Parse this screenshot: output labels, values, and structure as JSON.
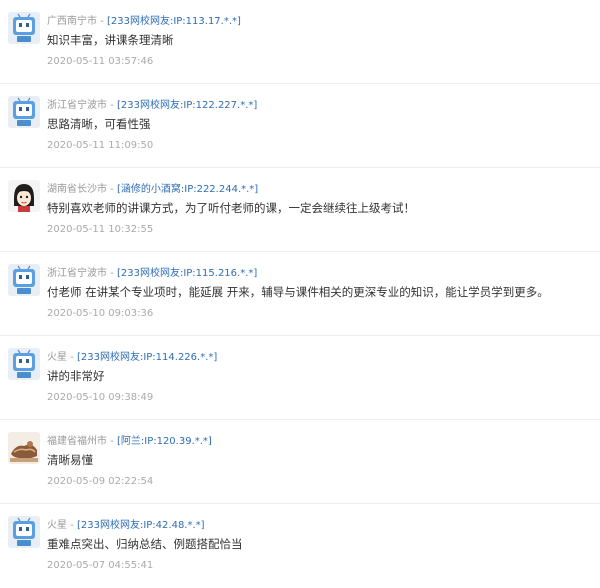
{
  "comments": [
    {
      "location": "广西南宁市",
      "user": "[233网校网友:IP:113.17.*.*]",
      "text": "知识丰富，讲课条理清晰",
      "time": "2020-05-11 03:57:46",
      "avatar": "robot-avatar-icon"
    },
    {
      "location": "浙江省宁波市",
      "user": "[233网校网友:IP:122.227.*.*]",
      "text": "思路清晰，可看性强",
      "time": "2020-05-11 11:09:50",
      "avatar": "robot-avatar-icon"
    },
    {
      "location": "湖南省长沙市",
      "user": "[涵修的小酒窝:IP:222.244.*.*]",
      "text": "特别喜欢老师的讲课方式，为了听付老师的课，一定会继续往上级考试！",
      "time": "2020-05-11 10:32:55",
      "avatar": "cartoon-girl-avatar-icon"
    },
    {
      "location": "浙江省宁波市",
      "user": "[233网校网友:IP:115.216.*.*]",
      "text": "付老师 在讲某个专业项时，能延展 开来，辅导与课件相关的更深专业的知识，能让学员学到更多。",
      "time": "2020-05-10 09:03:36",
      "avatar": "robot-avatar-icon"
    },
    {
      "location": "火星",
      "user": "[233网校网友:IP:114.226.*.*]",
      "text": "讲的非常好",
      "time": "2020-05-10 09:38:49",
      "avatar": "robot-avatar-icon"
    },
    {
      "location": "福建省福州市",
      "user": "[阿兰:IP:120.39.*.*]",
      "text": "清晰易懂",
      "time": "2020-05-09 02:22:54",
      "avatar": "photo-avatar-icon"
    },
    {
      "location": "火星",
      "user": "[233网校网友:IP:42.48.*.*]",
      "text": "重难点突出、归纳总结、例题搭配恰当",
      "time": "2020-05-07 04:55:41",
      "avatar": "robot-avatar-icon"
    }
  ],
  "separator": " - "
}
